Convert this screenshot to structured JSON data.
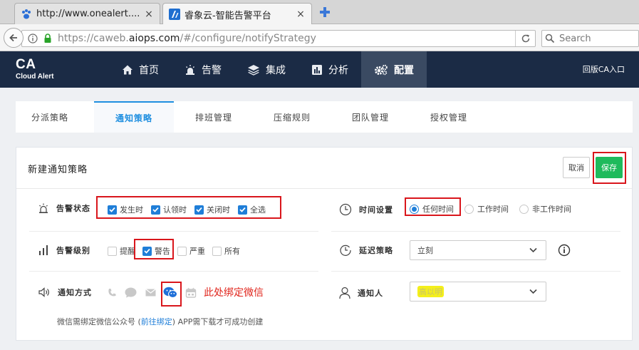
{
  "browser": {
    "tabs": [
      {
        "title": "http://www.onealert....",
        "close": "×"
      },
      {
        "title": "睿象云-智能告警平台",
        "close": "×"
      }
    ],
    "url": {
      "prefix": "https://caweb.",
      "domain": "aiops.com",
      "path": "/#/configure/notifyStrategy"
    },
    "search_placeholder": "Search"
  },
  "header": {
    "logo_title": "CA",
    "logo_subtitle": "Cloud Alert",
    "nav": [
      {
        "label": "首页",
        "icon": "home-icon"
      },
      {
        "label": "告警",
        "icon": "alarm-light-icon"
      },
      {
        "label": "集成",
        "icon": "layers-icon"
      },
      {
        "label": "分析",
        "icon": "bar-chart-icon"
      },
      {
        "label": "配置",
        "icon": "gears-icon",
        "active": true
      }
    ],
    "old_version": "回版CA入口"
  },
  "subtabs": [
    {
      "label": "分派策略"
    },
    {
      "label": "通知策略",
      "active": true
    },
    {
      "label": "排班管理"
    },
    {
      "label": "压缩规则"
    },
    {
      "label": "团队管理"
    },
    {
      "label": "授权管理"
    }
  ],
  "card": {
    "title": "新建通知策略",
    "cancel": "取消",
    "save": "保存",
    "alert_status": {
      "label": "告警状态",
      "options": [
        {
          "label": "发生时",
          "checked": true
        },
        {
          "label": "认领时",
          "checked": true
        },
        {
          "label": "关闭时",
          "checked": true
        },
        {
          "label": "全选",
          "checked": true
        }
      ]
    },
    "alert_level": {
      "label": "告警级别",
      "options": [
        {
          "label": "提醒",
          "checked": false
        },
        {
          "label": "警告",
          "checked": true
        },
        {
          "label": "严重",
          "checked": false
        },
        {
          "label": "所有",
          "checked": false
        }
      ]
    },
    "notify_method": {
      "label": "通知方式",
      "icons": [
        "phone-icon",
        "chat-bubble-icon",
        "mail-icon",
        "wechat-icon",
        "app-icon"
      ],
      "annotation": "此处绑定微信",
      "hint_prefix": "微信需绑定微信公众号 (",
      "hint_link": "前往绑定",
      "hint_suffix": ") APP需下载才可成功创建"
    },
    "time_setting": {
      "label": "时间设置",
      "options": [
        {
          "label": "任何时间",
          "checked": true
        },
        {
          "label": "工作时间",
          "checked": false
        },
        {
          "label": "非工作时间",
          "checked": false
        }
      ]
    },
    "delay_strategy": {
      "label": "延迟策略",
      "value": "立刻"
    },
    "notifier": {
      "label": "通知人",
      "value": "高以明"
    },
    "colors": {
      "primary": "#1f7ed8",
      "save": "#1fba5c",
      "header": "#1b2b45",
      "highlight": "#d9161c"
    }
  }
}
